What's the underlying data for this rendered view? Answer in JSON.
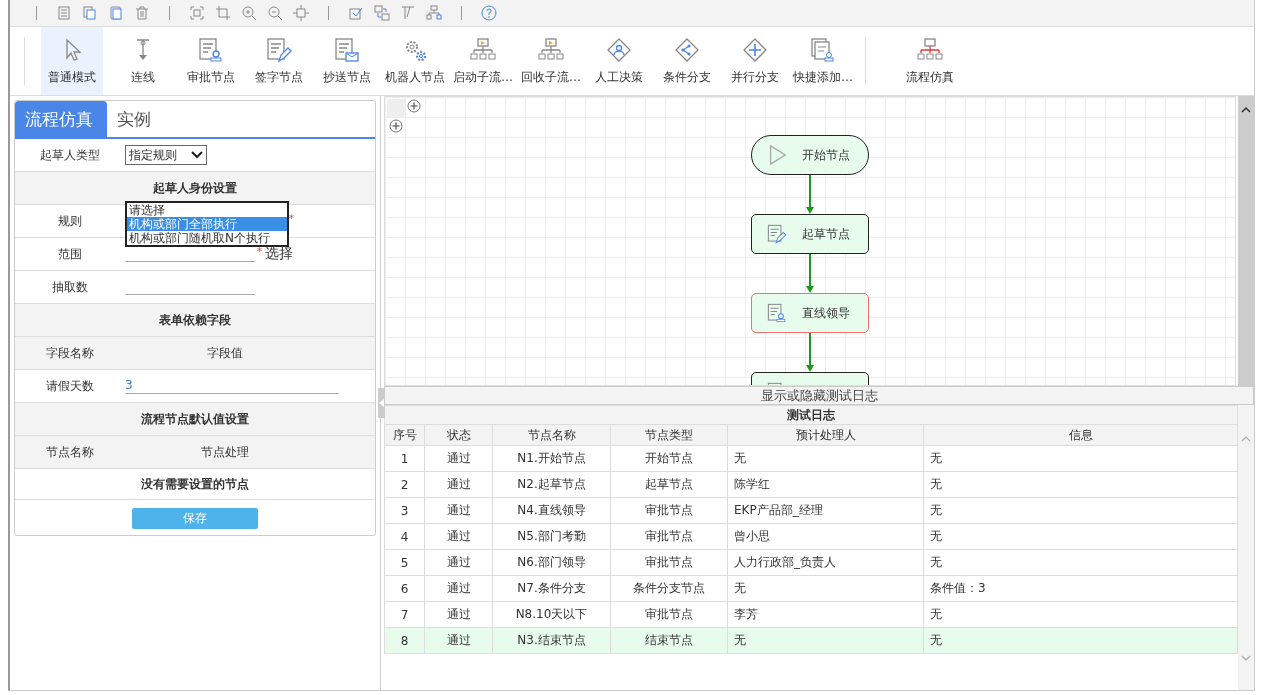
{
  "toolbar": {
    "tools": [
      {
        "label": "普通模式",
        "selected": true
      },
      {
        "label": "连线",
        "selected": false
      },
      {
        "label": "审批节点",
        "selected": false
      },
      {
        "label": "签字节点",
        "selected": false
      },
      {
        "label": "抄送节点",
        "selected": false
      },
      {
        "label": "机器人节点",
        "selected": false
      },
      {
        "label": "启动子流…",
        "selected": false
      },
      {
        "label": "回收子流…",
        "selected": false
      },
      {
        "label": "人工决策",
        "selected": false
      },
      {
        "label": "条件分支",
        "selected": false
      },
      {
        "label": "并行分支",
        "selected": false
      },
      {
        "label": "快捷添加…",
        "selected": false
      }
    ],
    "simulate": {
      "label": "流程仿真"
    }
  },
  "panel": {
    "tabs": [
      {
        "label": "流程仿真",
        "selected": true
      },
      {
        "label": "实例",
        "selected": false
      }
    ],
    "drafter_type": {
      "label": "起草人类型",
      "value": "指定规则"
    },
    "identity_section": {
      "title": "起草人身份设置",
      "rule": {
        "label": "规则",
        "required_mark": "*",
        "options": [
          {
            "label": "请选择",
            "selected": false
          },
          {
            "label": "机构或部门全部执行",
            "selected": true
          },
          {
            "label": "机构或部门随机取N个执行",
            "selected": false
          }
        ]
      },
      "scope": {
        "label": "范围",
        "required_mark": "*",
        "link": "选择"
      },
      "count": {
        "label": "抽取数"
      }
    },
    "form_section": {
      "title": "表单依赖字段",
      "columns": [
        "字段名称",
        "字段值"
      ],
      "rows": [
        {
          "name": "请假天数",
          "value": "3"
        }
      ]
    },
    "node_section": {
      "title": "流程节点默认值设置",
      "columns": [
        "节点名称",
        "节点处理"
      ],
      "empty": "没有需要设置的节点"
    },
    "save_button": "保存"
  },
  "canvas": {
    "nodes": [
      {
        "kind": "start",
        "label": "开始节点",
        "highlighted": false
      },
      {
        "kind": "draft",
        "label": "起草节点",
        "highlighted": false
      },
      {
        "kind": "approval",
        "label": "直线领导",
        "highlighted": true
      },
      {
        "kind": "approval",
        "highlighted": false
      }
    ]
  },
  "log": {
    "toggle": "显示或隐藏测试日志",
    "title": "测试日志",
    "columns": [
      "序号",
      "状态",
      "节点名称",
      "节点类型",
      "预计处理人",
      "信息"
    ],
    "rows": [
      {
        "cells": [
          "1",
          "通过",
          "N1.开始节点",
          "开始节点",
          "无",
          "无"
        ],
        "selected": false
      },
      {
        "cells": [
          "2",
          "通过",
          "N2.起草节点",
          "起草节点",
          "陈学红",
          "无"
        ],
        "selected": false
      },
      {
        "cells": [
          "3",
          "通过",
          "N4.直线领导",
          "审批节点",
          "EKP产品部_经理",
          "无"
        ],
        "selected": false
      },
      {
        "cells": [
          "4",
          "通过",
          "N5.部门考勤",
          "审批节点",
          "曾小思",
          "无"
        ],
        "selected": false
      },
      {
        "cells": [
          "5",
          "通过",
          "N6.部门领导",
          "审批节点",
          "人力行政部_负责人",
          "无"
        ],
        "selected": false
      },
      {
        "cells": [
          "6",
          "通过",
          "N7.条件分支",
          "条件分支节点",
          "无",
          "条件值：3"
        ],
        "selected": false
      },
      {
        "cells": [
          "7",
          "通过",
          "N8.10天以下",
          "审批节点",
          "李芳",
          "无"
        ],
        "selected": false
      },
      {
        "cells": [
          "8",
          "通过",
          "N3.结束节点",
          "结束节点",
          "无",
          "无"
        ],
        "selected": true
      }
    ]
  }
}
